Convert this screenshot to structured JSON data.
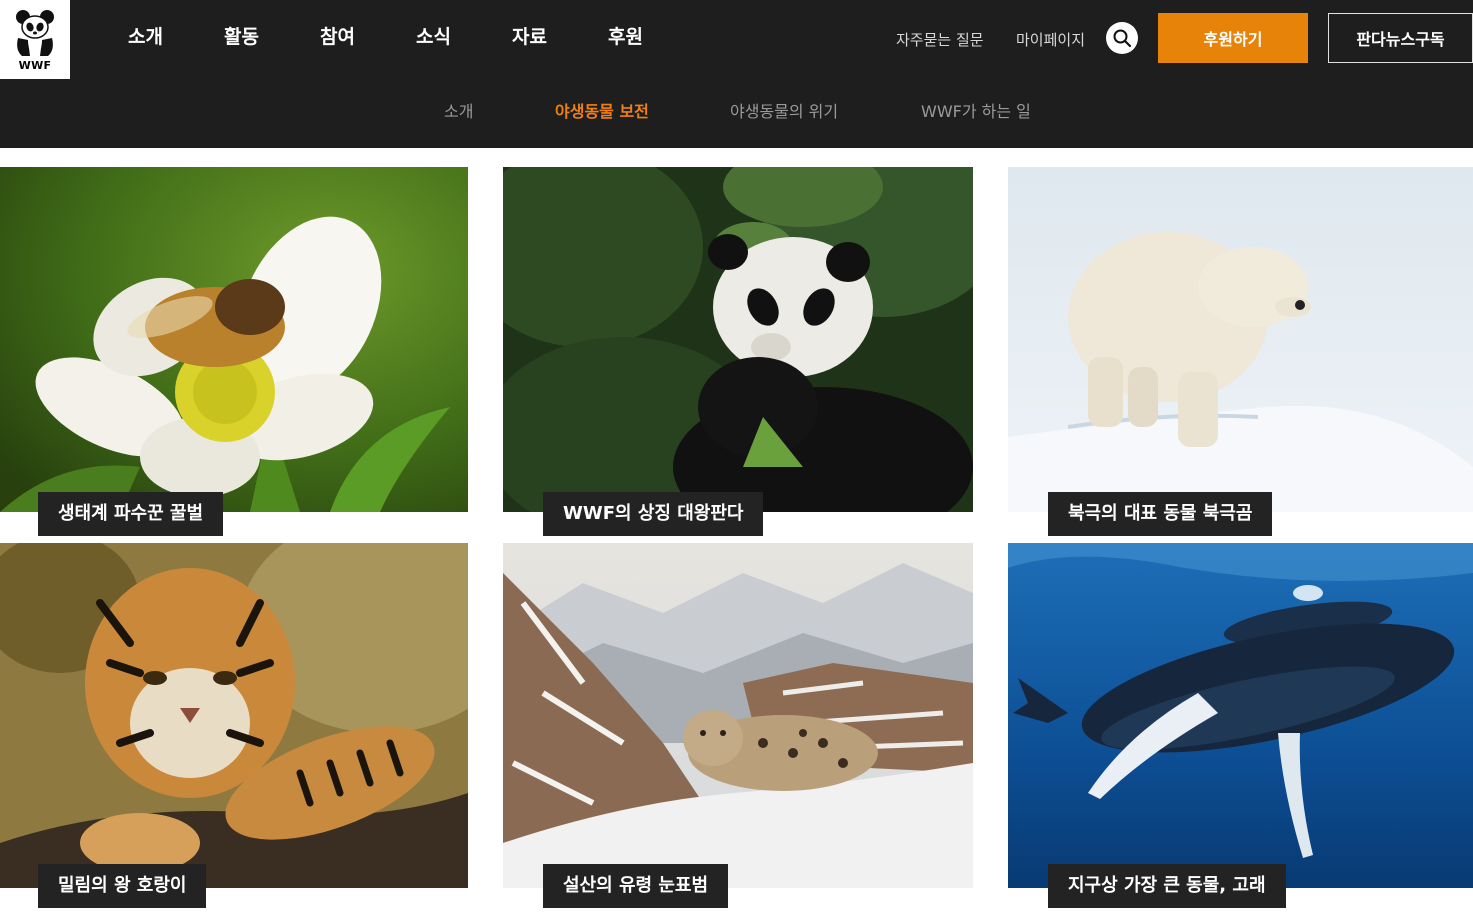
{
  "brand": {
    "logo_text": "WWF"
  },
  "main_nav": {
    "items": [
      {
        "label": "소개"
      },
      {
        "label": "활동"
      },
      {
        "label": "참여"
      },
      {
        "label": "소식"
      },
      {
        "label": "자료"
      },
      {
        "label": "후원"
      }
    ]
  },
  "utility": {
    "faq": "자주묻는 질문",
    "mypage": "마이페이지",
    "search_icon": "search-icon",
    "donate": "후원하기",
    "subscribe": "판다뉴스구독"
  },
  "sub_nav": {
    "items": [
      {
        "label": "소개",
        "active": false
      },
      {
        "label": "야생동물 보전",
        "active": true
      },
      {
        "label": "야생동물의 위기",
        "active": false
      },
      {
        "label": "WWF가 하는 일",
        "active": false
      }
    ],
    "active_color": "#f07f16"
  },
  "colors": {
    "header_bg": "#1e1e1e",
    "accent": "#e8830a",
    "caption_bg": "#232323"
  },
  "cards": [
    {
      "caption": "생태계 파수꾼 꿀벌",
      "image": "bee-on-flower-photo"
    },
    {
      "caption": "WWF의 상징 대왕판다",
      "image": "giant-panda-photo"
    },
    {
      "caption": "북극의 대표 동물 북극곰",
      "image": "polar-bear-photo"
    },
    {
      "caption": "밀림의 왕 호랑이",
      "image": "tiger-photo"
    },
    {
      "caption": "설산의 유령 눈표범",
      "image": "snow-leopard-photo"
    },
    {
      "caption": "지구상 가장 큰 동물, 고래",
      "image": "humpback-whale-photo"
    }
  ]
}
